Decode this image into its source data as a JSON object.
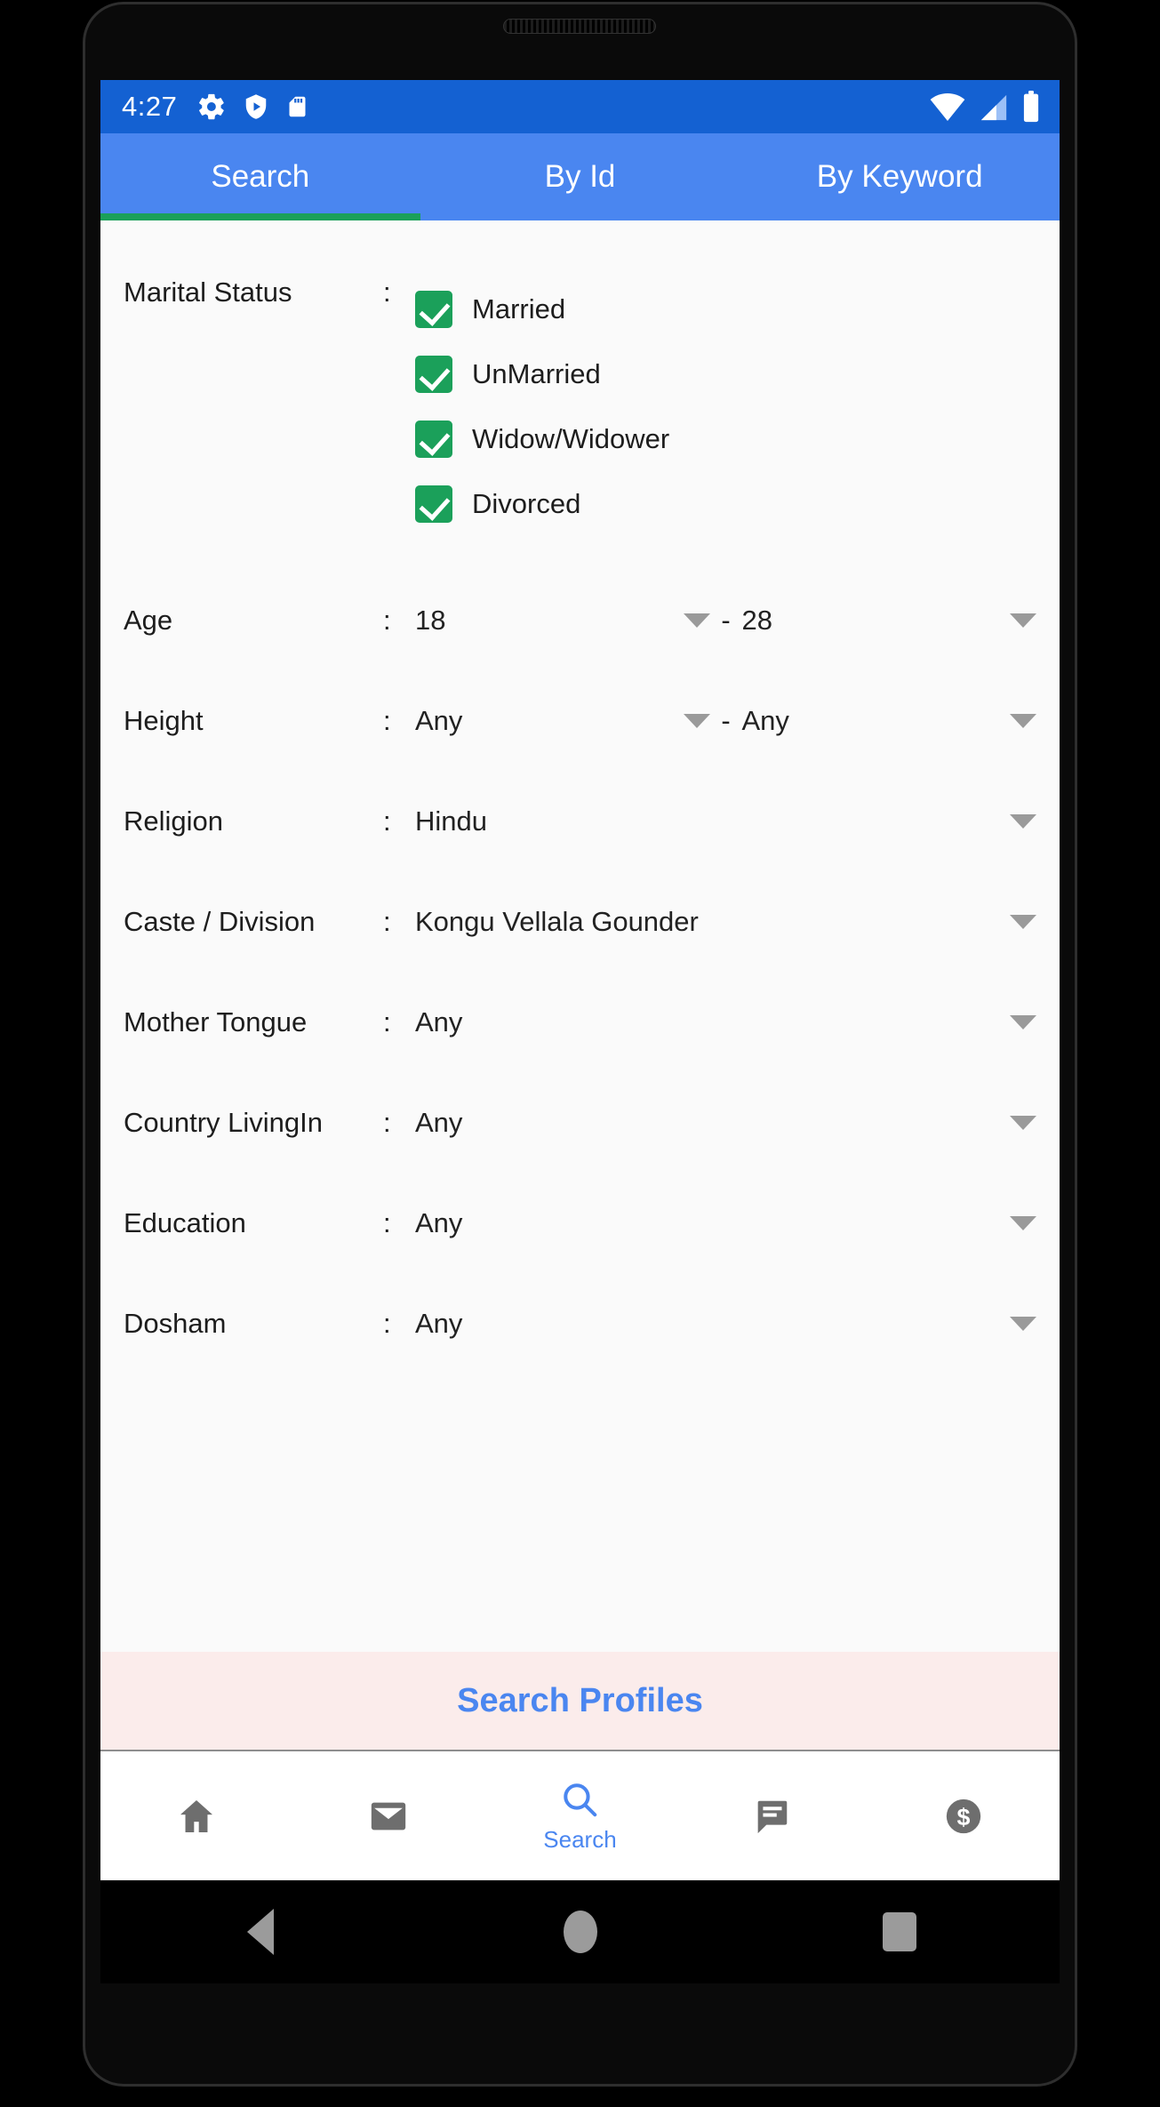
{
  "status_bar": {
    "clock": "4:27",
    "left_icons": [
      "gear-icon",
      "shield-play-icon",
      "sd-card-icon"
    ],
    "right_icons": [
      "wifi-icon",
      "cell-signal-icon",
      "battery-icon"
    ],
    "background": "#1461d2"
  },
  "tabs": {
    "active_index": 0,
    "indicator_color": "#1ba05a",
    "background": "#4a86f0",
    "items": [
      {
        "label": "Search"
      },
      {
        "label": "By Id"
      },
      {
        "label": "By Keyword"
      }
    ]
  },
  "form": {
    "marital_status": {
      "label": "Marital Status",
      "colon": ":",
      "options": [
        {
          "label": "Married",
          "checked": true
        },
        {
          "label": "UnMarried",
          "checked": true
        },
        {
          "label": "Widow/Widower",
          "checked": true
        },
        {
          "label": "Divorced",
          "checked": true
        }
      ],
      "checkbox_color": "#1ba05a"
    },
    "age": {
      "label": "Age",
      "colon": ":",
      "from": "18",
      "dash": "-",
      "to": "28"
    },
    "height": {
      "label": "Height",
      "colon": ":",
      "from": "Any",
      "dash": "-",
      "to": "Any"
    },
    "religion": {
      "label": "Religion",
      "colon": ":",
      "value": "Hindu"
    },
    "caste": {
      "label": "Caste / Division",
      "colon": ":",
      "value": "Kongu Vellala Gounder"
    },
    "mother_tongue": {
      "label": "Mother Tongue",
      "colon": ":",
      "value": "Any"
    },
    "country_livingin": {
      "label": "Country LivingIn",
      "colon": ":",
      "value": "Any"
    },
    "education": {
      "label": "Education",
      "colon": ":",
      "value": "Any"
    },
    "dosham": {
      "label": "Dosham",
      "colon": ":",
      "value": "Any"
    }
  },
  "search_button": {
    "label": "Search Profiles",
    "text_color": "#4a86f0",
    "background": "#fbeceb"
  },
  "bottom_nav": {
    "active_index": 2,
    "active_color": "#4a86f0",
    "inactive_color": "#6e6e6e",
    "items": [
      {
        "icon": "home-icon",
        "label": ""
      },
      {
        "icon": "email-icon",
        "label": ""
      },
      {
        "icon": "search-icon",
        "label": "Search"
      },
      {
        "icon": "chat-icon",
        "label": ""
      },
      {
        "icon": "dollar-coin-icon",
        "label": ""
      }
    ]
  },
  "android_nav": {
    "items": [
      "back-icon",
      "home-icon",
      "recents-icon"
    ]
  }
}
